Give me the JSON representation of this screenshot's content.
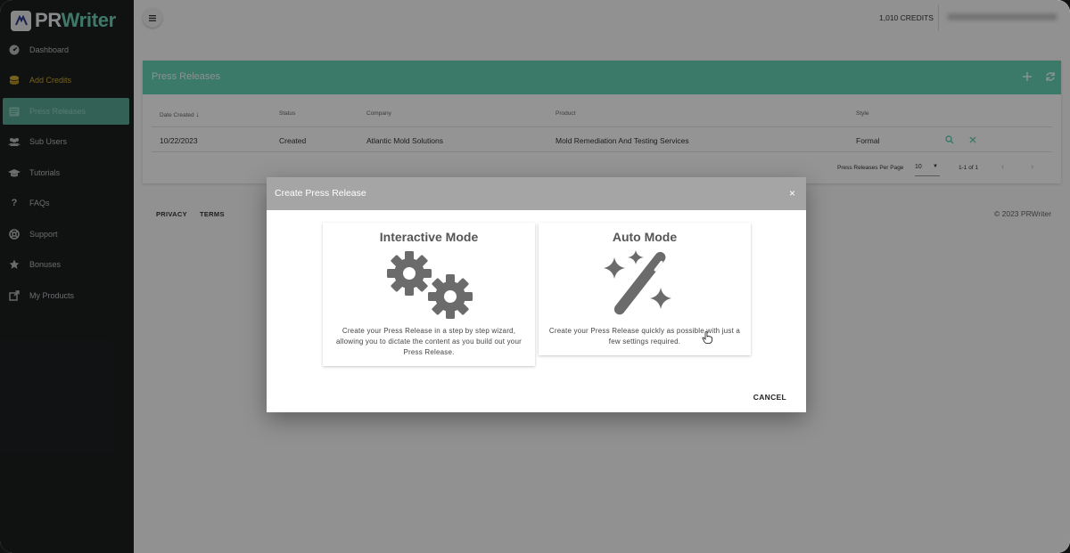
{
  "app": {
    "logo_prefix": "PR",
    "logo_suffix": "Writer"
  },
  "sidebar": {
    "items": [
      {
        "label": "Dashboard",
        "icon": "gauge-icon"
      },
      {
        "label": "Add Credits",
        "icon": "coins-icon"
      },
      {
        "label": "Press Releases",
        "icon": "newspaper-icon"
      },
      {
        "label": "Sub Users",
        "icon": "users-icon"
      },
      {
        "label": "Tutorials",
        "icon": "graduation-cap-icon"
      },
      {
        "label": "FAQs",
        "icon": "question-icon"
      },
      {
        "label": "Support",
        "icon": "lifebuoy-icon"
      },
      {
        "label": "Bonuses",
        "icon": "star-icon"
      },
      {
        "label": "My Products",
        "icon": "external-link-icon"
      }
    ]
  },
  "topbar": {
    "credits": "1,010 CREDITS"
  },
  "press_releases": {
    "title": "Press Releases",
    "columns": [
      "Date Created",
      "Status",
      "Company",
      "Product",
      "Style"
    ],
    "rows": [
      {
        "date": "10/22/2023",
        "status": "Created",
        "company": "Atlantic Mold Solutions",
        "product": "Mold Remediation And Testing Services",
        "style": "Formal"
      }
    ],
    "per_page_label": "Press Releases Per Page",
    "per_page_value": "10",
    "range": "1-1 of 1"
  },
  "footer": {
    "privacy": "PRIVACY",
    "terms": "TERMS",
    "copyright": "© 2023 PRWriter"
  },
  "dialog": {
    "title": "Create Press Release",
    "close": "×",
    "interactive": {
      "title": "Interactive Mode",
      "description": "Create your Press Release in a step by step wizard, allowing you to dictate the content as you build out your Press Release."
    },
    "auto": {
      "title": "Auto Mode",
      "description": "Create your Press Release quickly as possible with just a few settings required."
    },
    "cancel": "CANCEL"
  },
  "colors": {
    "accent": "#66d1b3",
    "sidebar_bg": "#1d1f20",
    "credits_gold": "#c8a832"
  }
}
